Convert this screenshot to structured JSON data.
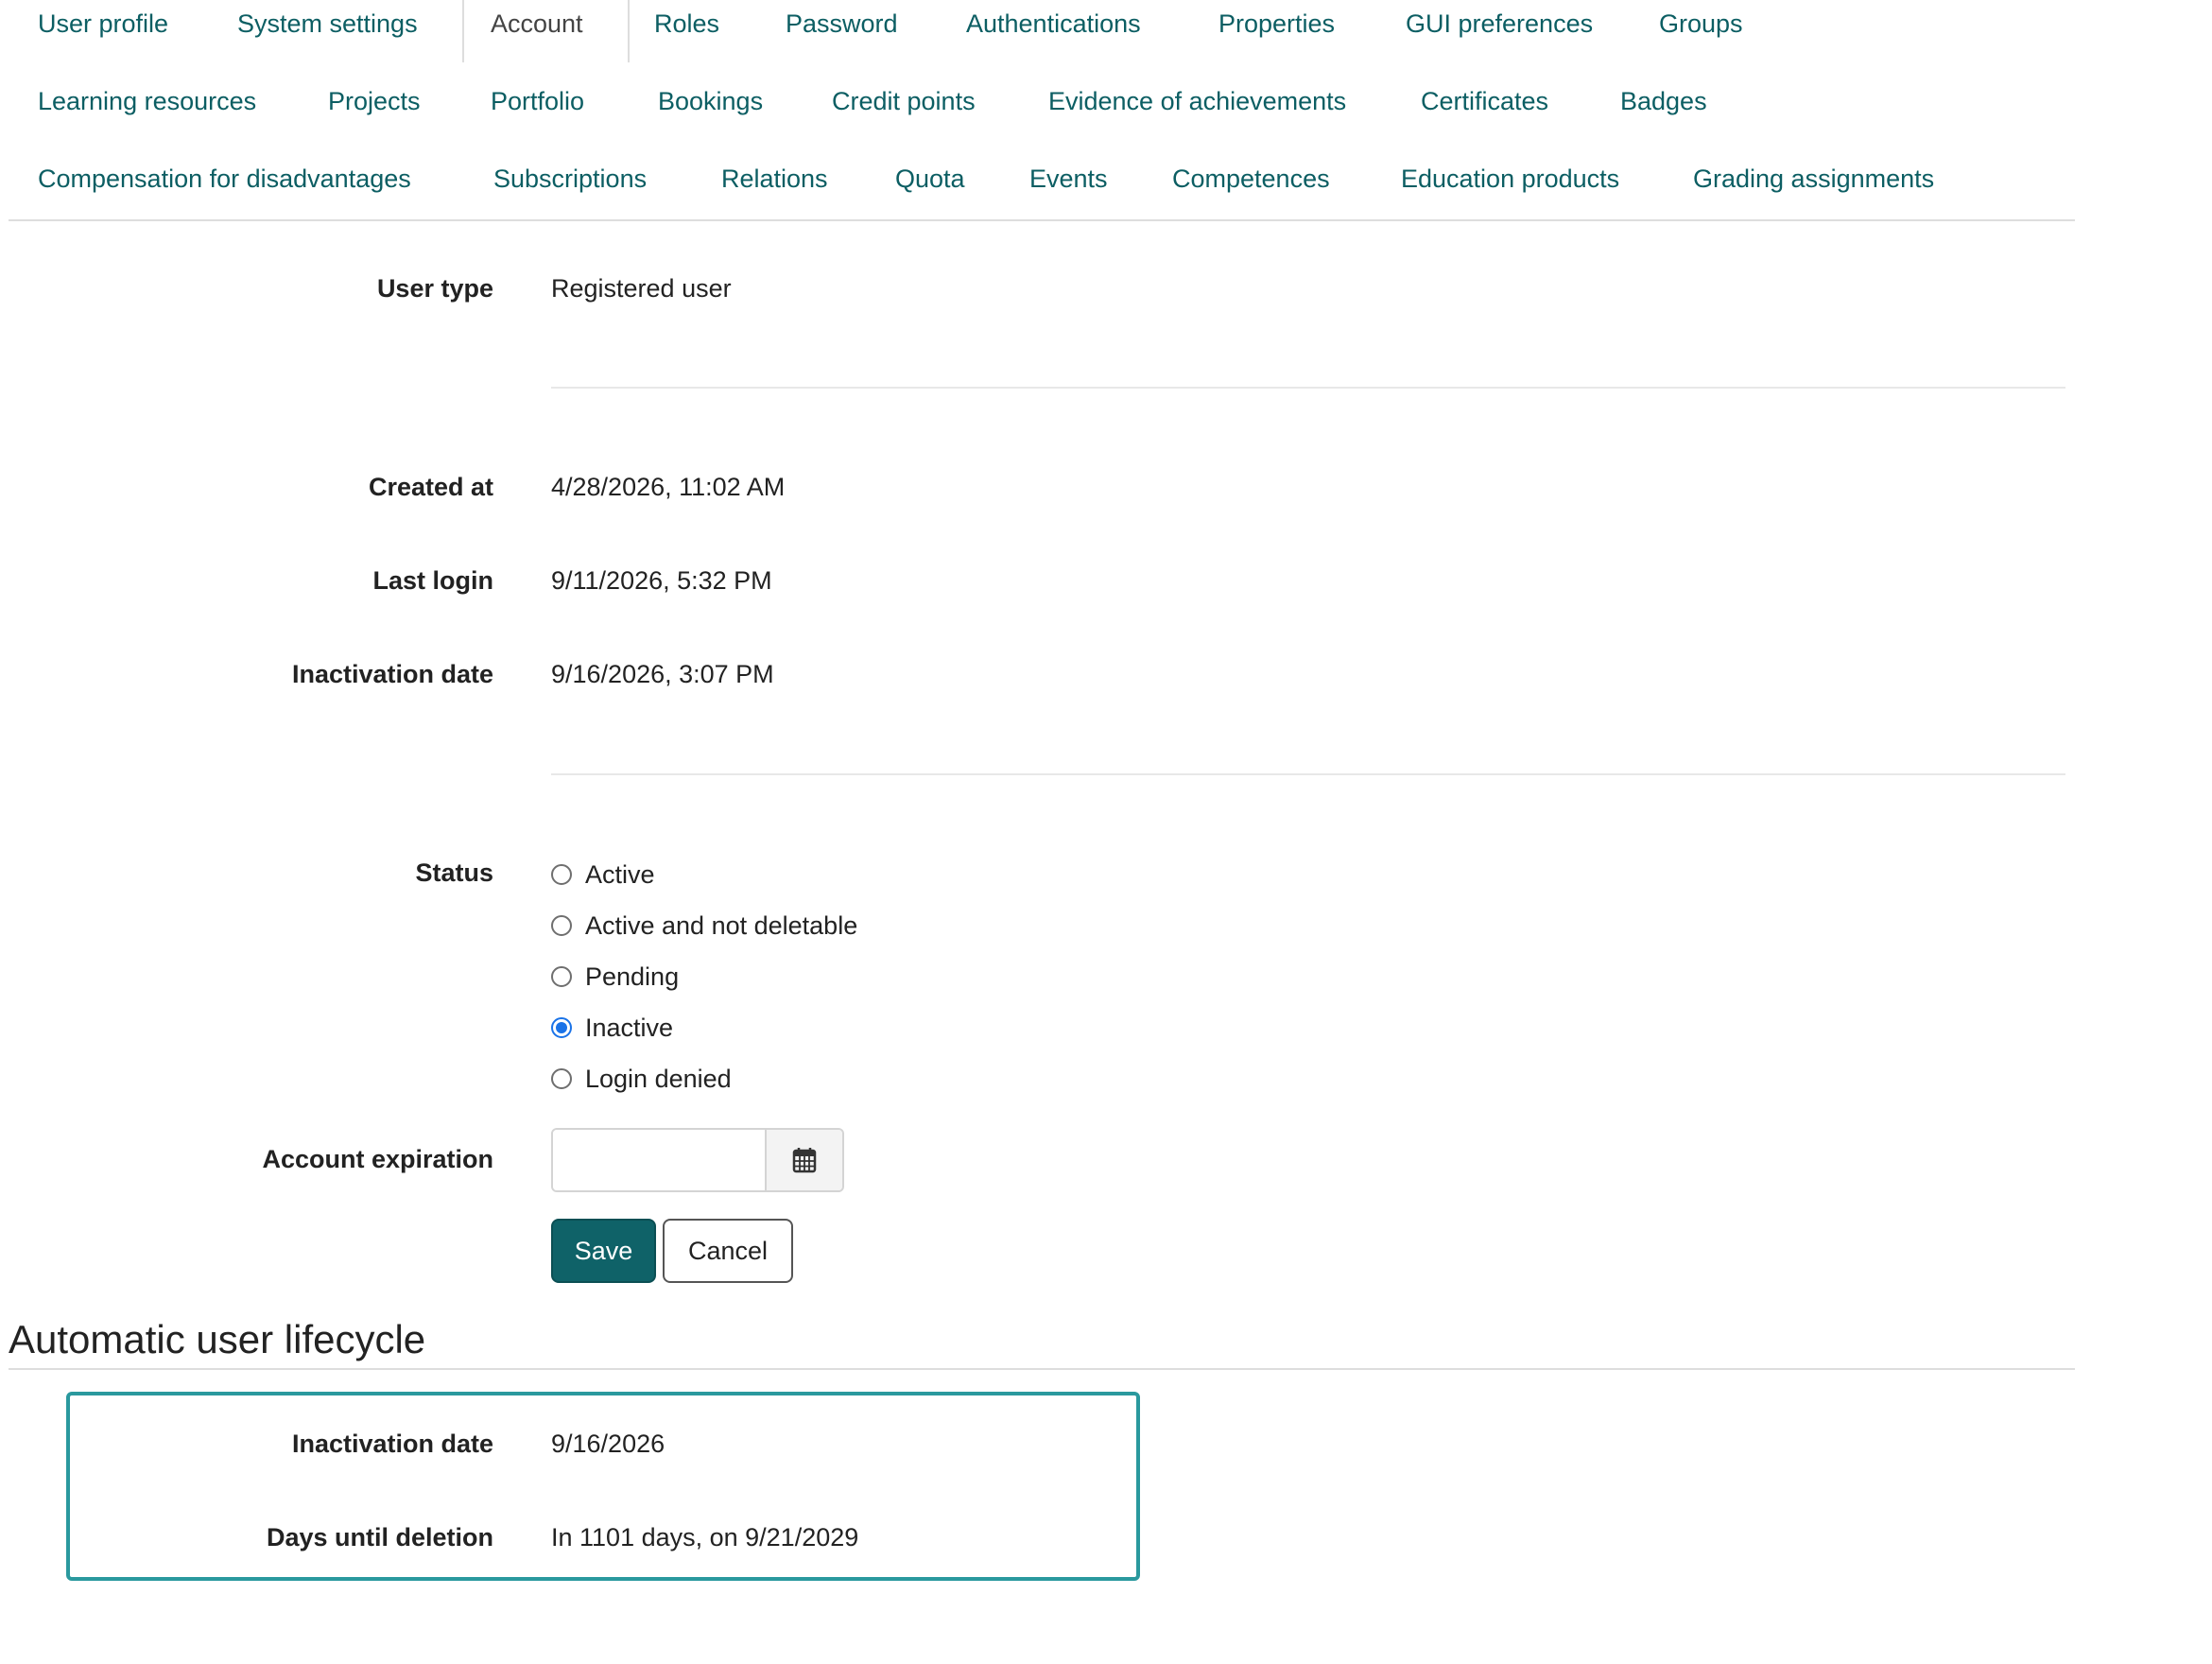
{
  "tabs": {
    "row1": [
      {
        "label": "User profile"
      },
      {
        "label": "System settings"
      },
      {
        "label": "Account"
      },
      {
        "label": "Roles"
      },
      {
        "label": "Password"
      },
      {
        "label": "Authentications"
      },
      {
        "label": "Properties"
      },
      {
        "label": "GUI preferences"
      },
      {
        "label": "Groups"
      }
    ],
    "row2": [
      {
        "label": "Learning resources"
      },
      {
        "label": "Projects"
      },
      {
        "label": "Portfolio"
      },
      {
        "label": "Bookings"
      },
      {
        "label": "Credit points"
      },
      {
        "label": "Evidence of achievements"
      },
      {
        "label": "Certificates"
      },
      {
        "label": "Badges"
      }
    ],
    "row3": [
      {
        "label": "Compensation for disadvantages"
      },
      {
        "label": "Subscriptions"
      },
      {
        "label": "Relations"
      },
      {
        "label": "Quota"
      },
      {
        "label": "Events"
      },
      {
        "label": "Competences"
      },
      {
        "label": "Education products"
      },
      {
        "label": "Grading assignments"
      }
    ],
    "active": "Account"
  },
  "account": {
    "user_type_label": "User type",
    "user_type_value": "Registered user",
    "created_at_label": "Created at",
    "created_at_value": "4/28/2026, 11:02 AM",
    "last_login_label": "Last login",
    "last_login_value": "9/11/2026, 5:32 PM",
    "inactivation_date_label": "Inactivation date",
    "inactivation_date_value": "9/16/2026, 3:07 PM",
    "status_label": "Status",
    "status_options": [
      {
        "label": "Active",
        "checked": false
      },
      {
        "label": "Active and not deletable",
        "checked": false
      },
      {
        "label": "Pending",
        "checked": false
      },
      {
        "label": "Inactive",
        "checked": true
      },
      {
        "label": "Login denied",
        "checked": false
      }
    ],
    "expiration_label": "Account expiration",
    "expiration_value": "",
    "save_label": "Save",
    "cancel_label": "Cancel"
  },
  "lifecycle": {
    "title": "Automatic user lifecycle",
    "inactivation_date_label": "Inactivation date",
    "inactivation_date_value": "9/16/2026",
    "days_until_deletion_label": "Days until deletion",
    "days_until_deletion_value": "In 1101 days, on 9/21/2029"
  },
  "colors": {
    "tab_link": "#0c5e63",
    "primary_button": "#0f6268",
    "lifecycle_border": "#2a999e",
    "radio_checked": "#1a73e8"
  },
  "icons": {
    "date_picker": "calendar-icon"
  }
}
